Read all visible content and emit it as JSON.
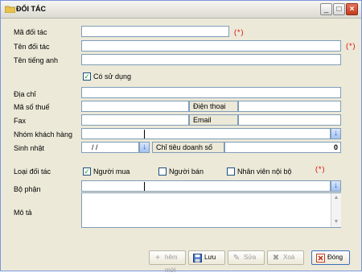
{
  "window": {
    "title": "ĐỐI TÁC",
    "minimize": "_",
    "maximize": "□",
    "close": "×"
  },
  "form": {
    "ma_doi_tac": {
      "label": "Mã đối tác",
      "value": "",
      "required": "(*)"
    },
    "ten_doi_tac": {
      "label": "Tên đối tác",
      "value": "",
      "required": "(*)"
    },
    "ten_tieng_anh": {
      "label": "Tên tiếng anh",
      "value": ""
    },
    "co_su_dung": {
      "label": "Có sử dụng",
      "checked": true
    },
    "dia_chi": {
      "label": "Địa chỉ",
      "value": ""
    },
    "ma_so_thue": {
      "label": "Mã số thuế",
      "value": ""
    },
    "dien_thoai": {
      "label": "Điện thoại",
      "value": ""
    },
    "fax": {
      "label": "Fax",
      "value": ""
    },
    "email": {
      "label": "Email",
      "value": ""
    },
    "nhom_khach_hang": {
      "label": "Nhóm khách hàng",
      "value": ""
    },
    "sinh_nhat": {
      "label": "Sinh nhật",
      "value": "/ /"
    },
    "chi_tieu_doanh_so": {
      "label": "Chỉ tiêu doanh số",
      "value": "0"
    },
    "loai_doi_tac": {
      "label": "Loại đối tác",
      "required": "(*)",
      "options": [
        {
          "label": "Người mua",
          "checked": true
        },
        {
          "label": "Người bán",
          "checked": false
        },
        {
          "label": "Nhân viên nội bộ",
          "checked": false
        }
      ]
    },
    "bo_phan": {
      "label": "Bộ phận",
      "value": ""
    },
    "mo_ta": {
      "label": "Mô tả",
      "value": ""
    }
  },
  "buttons": {
    "them_moi": {
      "label": "hêm mới",
      "icon": "add-icon"
    },
    "luu": {
      "label": "Lưu",
      "icon": "save-icon"
    },
    "sua": {
      "label": "Sửa",
      "icon": "edit-icon"
    },
    "xoa": {
      "label": "Xoá",
      "icon": "delete-icon"
    },
    "dong": {
      "label": "Đóng",
      "icon": "close-icon"
    }
  },
  "colors": {
    "required": "#e00000",
    "check": "#21a121",
    "dropdown_arrow": "#2458c8",
    "window_bg": "#ece9d8"
  }
}
